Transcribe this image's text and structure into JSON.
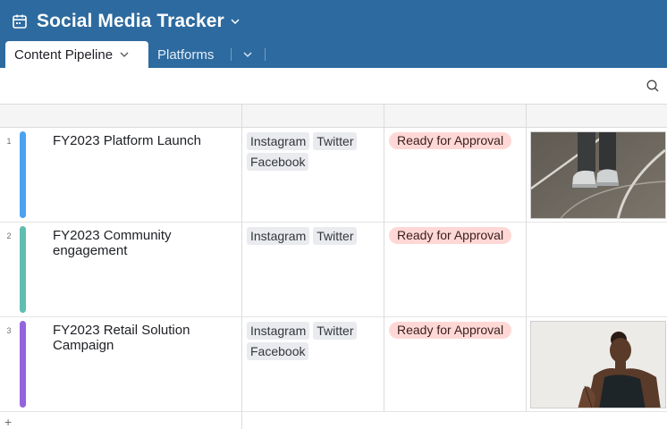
{
  "app": {
    "title": "Social Media Tracker",
    "icon": "calendar-icon",
    "header_color": "#2d6a9f"
  },
  "tabs": [
    {
      "label": "Content Pipeline",
      "active": true
    },
    {
      "label": "Platforms",
      "active": false
    }
  ],
  "toolbar": {
    "search_icon": "search-icon"
  },
  "rows": [
    {
      "number": "1",
      "name": "FY2023 Platform Launch",
      "bar_color": "#4aa3f0",
      "platforms": [
        "Instagram",
        "Twitter",
        "Facebook"
      ],
      "status": "Ready for Approval",
      "has_image": true,
      "image_subject": "sneakers-photo"
    },
    {
      "number": "2",
      "name": "FY2023 Community engagement",
      "bar_color": "#5fbeb0",
      "platforms": [
        "Instagram",
        "Twitter"
      ],
      "status": "Ready for Approval",
      "has_image": false
    },
    {
      "number": "3",
      "name": "FY2023 Retail Solution Campaign",
      "bar_color": "#9563dd",
      "platforms": [
        "Instagram",
        "Twitter",
        "Facebook"
      ],
      "status": "Ready for Approval",
      "has_image": true,
      "image_subject": "yoga-photo"
    }
  ],
  "status_color": "#ffd8d6",
  "add_row_label": "+"
}
